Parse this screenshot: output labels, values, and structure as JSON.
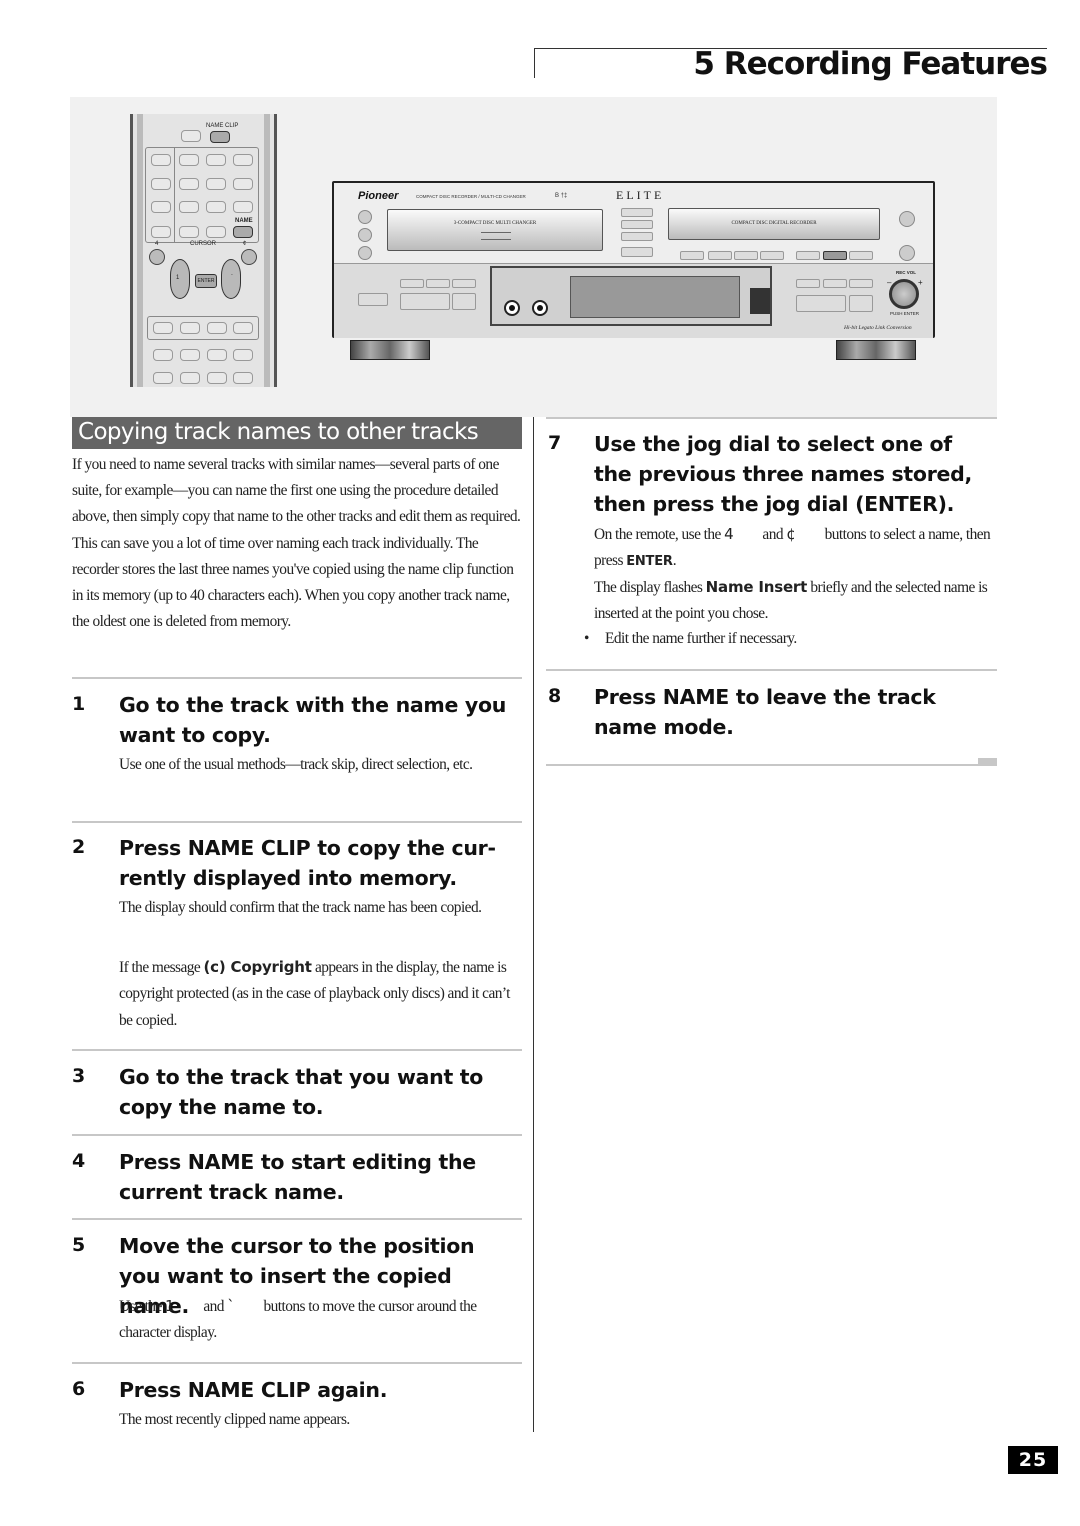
{
  "header": {
    "chapter_title": "5 Recording Features"
  },
  "illustration": {
    "remote": {
      "name_clip_label": "NAME CLIP",
      "name_label": "NAME",
      "cursor_label": "CURSOR",
      "prev_label": "4",
      "next_label": "¢",
      "left_label": "1",
      "right_label": "`",
      "enter_label": "ENTER"
    },
    "recorder": {
      "brand": "Pioneer",
      "brand_subtitle": "COMPACT DISC RECORDER / MULTI-CD CHANGER",
      "brand_mark": "B   †‡",
      "series": "ELITE",
      "changer_label": "3-COMPACT DISC MULTI CHANGER",
      "recorder_label": "COMPACT DISC DIGITAL RECORDER",
      "rec_vol_label": "REC VOL",
      "push_enter_label": "PUSH ENTER",
      "minus": "–",
      "plus": "+",
      "conversion_label": "Hi-bit Legato Link Conversion"
    }
  },
  "section": {
    "title": "Copying track names to other tracks",
    "intro": "If you need to name several tracks with similar names—several parts of one suite, for example—you can name the first one using the procedure detailed above, then simply copy that name to the other tracks and edit them as required. This can save you a lot of time over naming each track individually. The recorder stores the last three names you've copied using the name clip function in its memory (up to 40 characters each). When you copy another track name, the oldest one is deleted from memory."
  },
  "steps": [
    {
      "num": "1",
      "title": "Go to the track with the name you want to copy.",
      "body": "Use one of the usual methods—track skip, direct selection, etc."
    },
    {
      "num": "2",
      "title": "Press NAME CLIP to copy the cur-rently displayed into memory.",
      "body": "The display should confirm that the track name has been copied.",
      "body2_pre": "If the message ",
      "body2_bold": "(c) Copyright",
      "body2_post": " appears in the display, the name is copyright protected (as in the case of playback only discs) and it can’t be copied."
    },
    {
      "num": "3",
      "title": "Go to the track that you want to copy the name to."
    },
    {
      "num": "4",
      "title": "Press NAME to start editing the current track name."
    },
    {
      "num": "5",
      "title": "Move the cursor to the position you want to insert the copied name.",
      "body_pre": "Use the ",
      "sym1": "1",
      "body_mid": " and ",
      "sym2": "`",
      "body_post": " buttons to move the cursor around the character display."
    },
    {
      "num": "6",
      "title": "Press NAME CLIP again.",
      "body": "The most recently clipped name appears."
    },
    {
      "num": "7",
      "title": "Use the jog dial to select one of the previous three names stored, then press the jog dial (ENTER).",
      "body_pre": "On the remote, use the ",
      "sym1": "4",
      "body_mid": " and ",
      "sym2": "¢",
      "body_post": " buttons to select a name, then press ",
      "body_bold": "ENTER",
      "body_end": ".",
      "body2_pre": "The display flashes ",
      "body2_bold": "Name Insert",
      "body2_post": " briefly and the selected name is inserted at the point you chose.",
      "bullet": "Edit the name further if necessary."
    },
    {
      "num": "8",
      "title": "Press NAME to leave the track name mode."
    }
  ],
  "footer": {
    "page_number": "25"
  }
}
